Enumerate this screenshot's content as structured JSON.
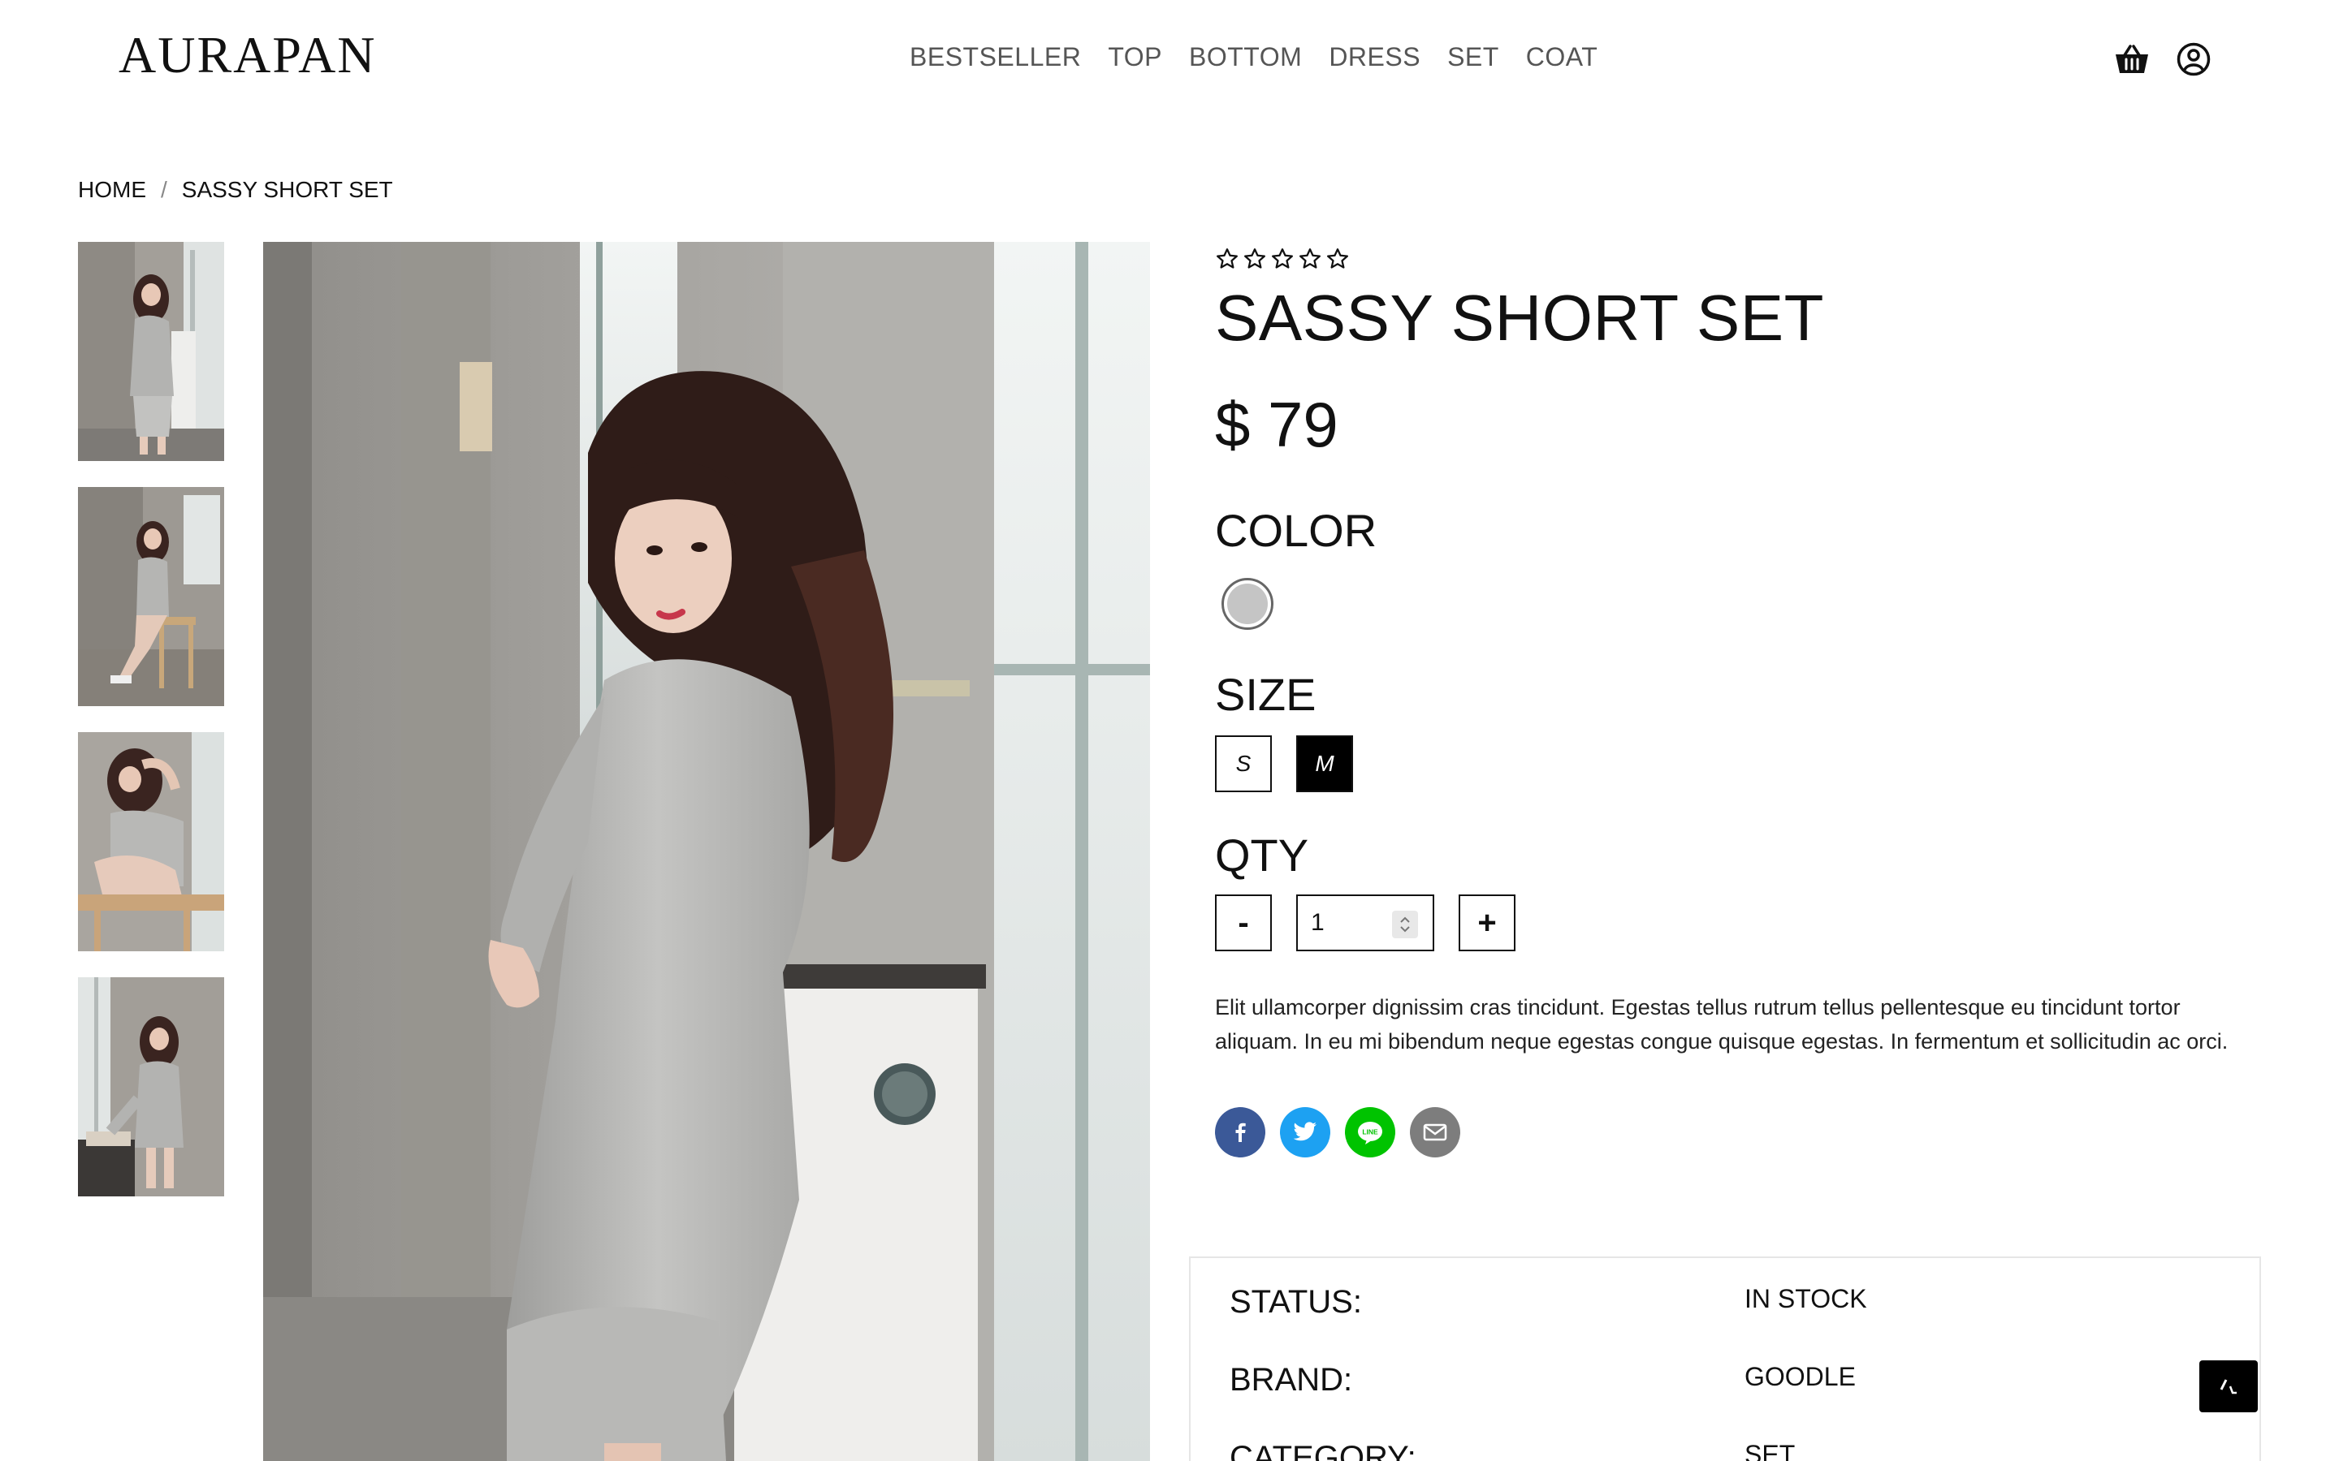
{
  "header": {
    "logo": "AURAPAN",
    "nav": [
      "BESTSELLER",
      "TOP",
      "BOTTOM",
      "DRESS",
      "SET",
      "COAT"
    ],
    "icons": [
      "cart-icon",
      "user-icon"
    ]
  },
  "breadcrumb": {
    "home": "HOME",
    "separator": "/",
    "current": "SASSY SHORT SET"
  },
  "product": {
    "rating": 0,
    "rating_max": 5,
    "title": "SASSY SHORT SET",
    "price": "$ 79",
    "color_label": "COLOR",
    "colors": [
      {
        "name": "grey",
        "hex": "#c5c5c5"
      }
    ],
    "size_label": "SIZE",
    "sizes": [
      "S",
      "M"
    ],
    "selected_size": "M",
    "qty_label": "QTY",
    "qty_minus": "-",
    "qty_plus": "+",
    "qty_value": "1",
    "description": "Elit ullamcorper dignissim cras tincidunt. Egestas tellus rutrum tellus pellentesque eu tincidunt tortor aliquam. In eu mi bibendum neque egestas congue quisque egestas. In fermentum et sollicitudin ac orci.",
    "share": [
      {
        "name": "facebook-icon",
        "color": "#3b5998"
      },
      {
        "name": "twitter-icon",
        "color": "#1da1f2"
      },
      {
        "name": "line-icon",
        "color": "#00c300"
      },
      {
        "name": "email-icon",
        "color": "#7d7d7d"
      }
    ]
  },
  "details": [
    {
      "key": "STATUS:",
      "value": "IN STOCK"
    },
    {
      "key": "BRAND:",
      "value": "GOODLE"
    },
    {
      "key": "CATEGORY:",
      "value": "SET"
    }
  ],
  "gallery": {
    "thumbnail_count": 4
  }
}
